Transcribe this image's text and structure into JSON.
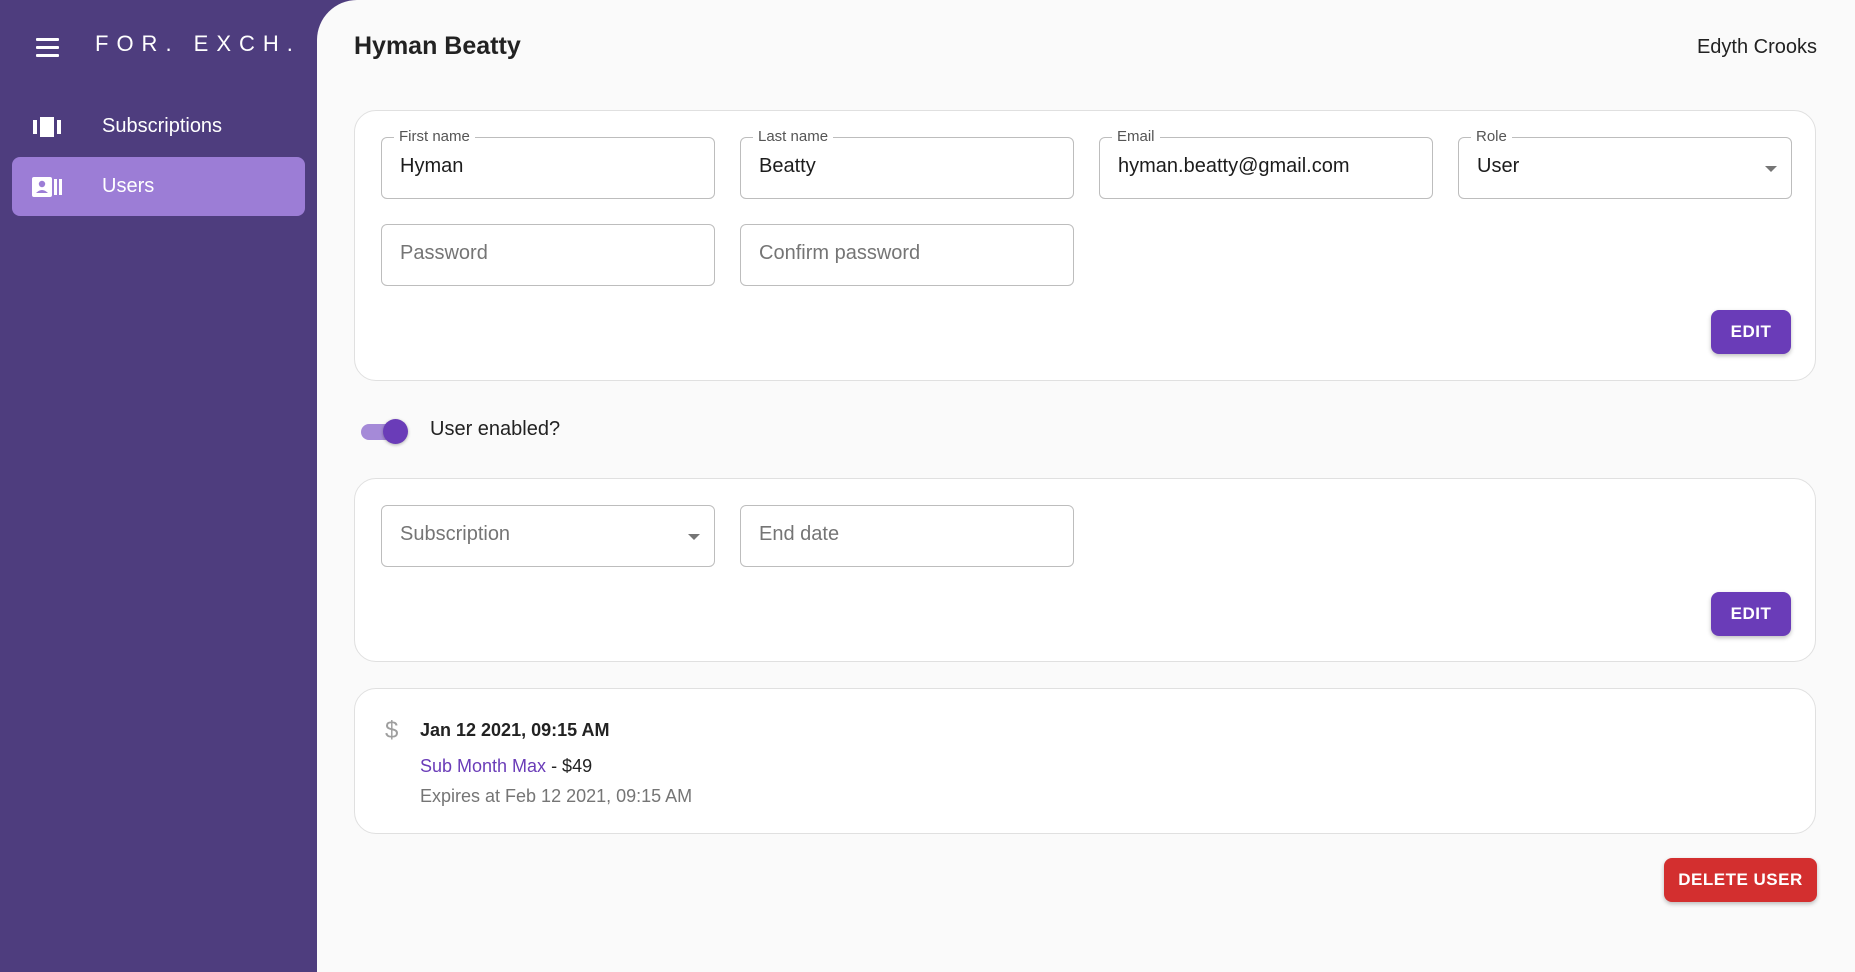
{
  "sidebar": {
    "logo": "FOR. EXCH.",
    "items": [
      {
        "label": "Subscriptions",
        "icon": "view-carousel-icon",
        "active": false
      },
      {
        "label": "Users",
        "icon": "contact-card-icon",
        "active": true
      }
    ]
  },
  "header": {
    "title": "Hyman Beatty",
    "current_user": "Edyth Crooks"
  },
  "profile_form": {
    "first_name": {
      "label": "First name",
      "value": "Hyman"
    },
    "last_name": {
      "label": "Last name",
      "value": "Beatty"
    },
    "email": {
      "label": "Email",
      "value": "hyman.beatty@gmail.com"
    },
    "role": {
      "label": "Role",
      "value": "User"
    },
    "password": {
      "placeholder": "Password"
    },
    "confirm_password": {
      "placeholder": "Confirm password"
    },
    "edit_label": "EDIT"
  },
  "enabled_toggle": {
    "label": "User enabled?",
    "checked": true
  },
  "subscription_form": {
    "subscription": {
      "placeholder": "Subscription"
    },
    "end_date": {
      "placeholder": "End date"
    },
    "edit_label": "EDIT"
  },
  "transactions": [
    {
      "icon": "dollar-icon",
      "date": "Jan 12 2021, 09:15 AM",
      "plan": "Sub Month Max",
      "price": " - $49",
      "expires": "Expires at Feb 12 2021, 09:15 AM"
    }
  ],
  "actions": {
    "delete_label": "DELETE USER"
  },
  "colors": {
    "sidebar_bg": "#4e3d7e",
    "active_nav": "#9c7dd6",
    "primary": "#6a3cb8",
    "danger": "#d32f2f"
  }
}
